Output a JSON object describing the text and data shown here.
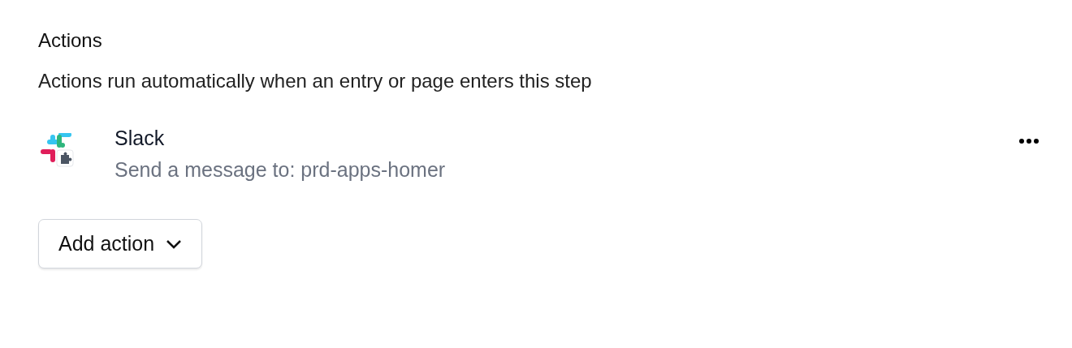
{
  "section": {
    "title": "Actions",
    "description": "Actions run automatically when an entry or page enters this step"
  },
  "actions": [
    {
      "name": "Slack",
      "detail": "Send a message to: prd-apps-homer"
    }
  ],
  "add_button": {
    "label": "Add action"
  }
}
